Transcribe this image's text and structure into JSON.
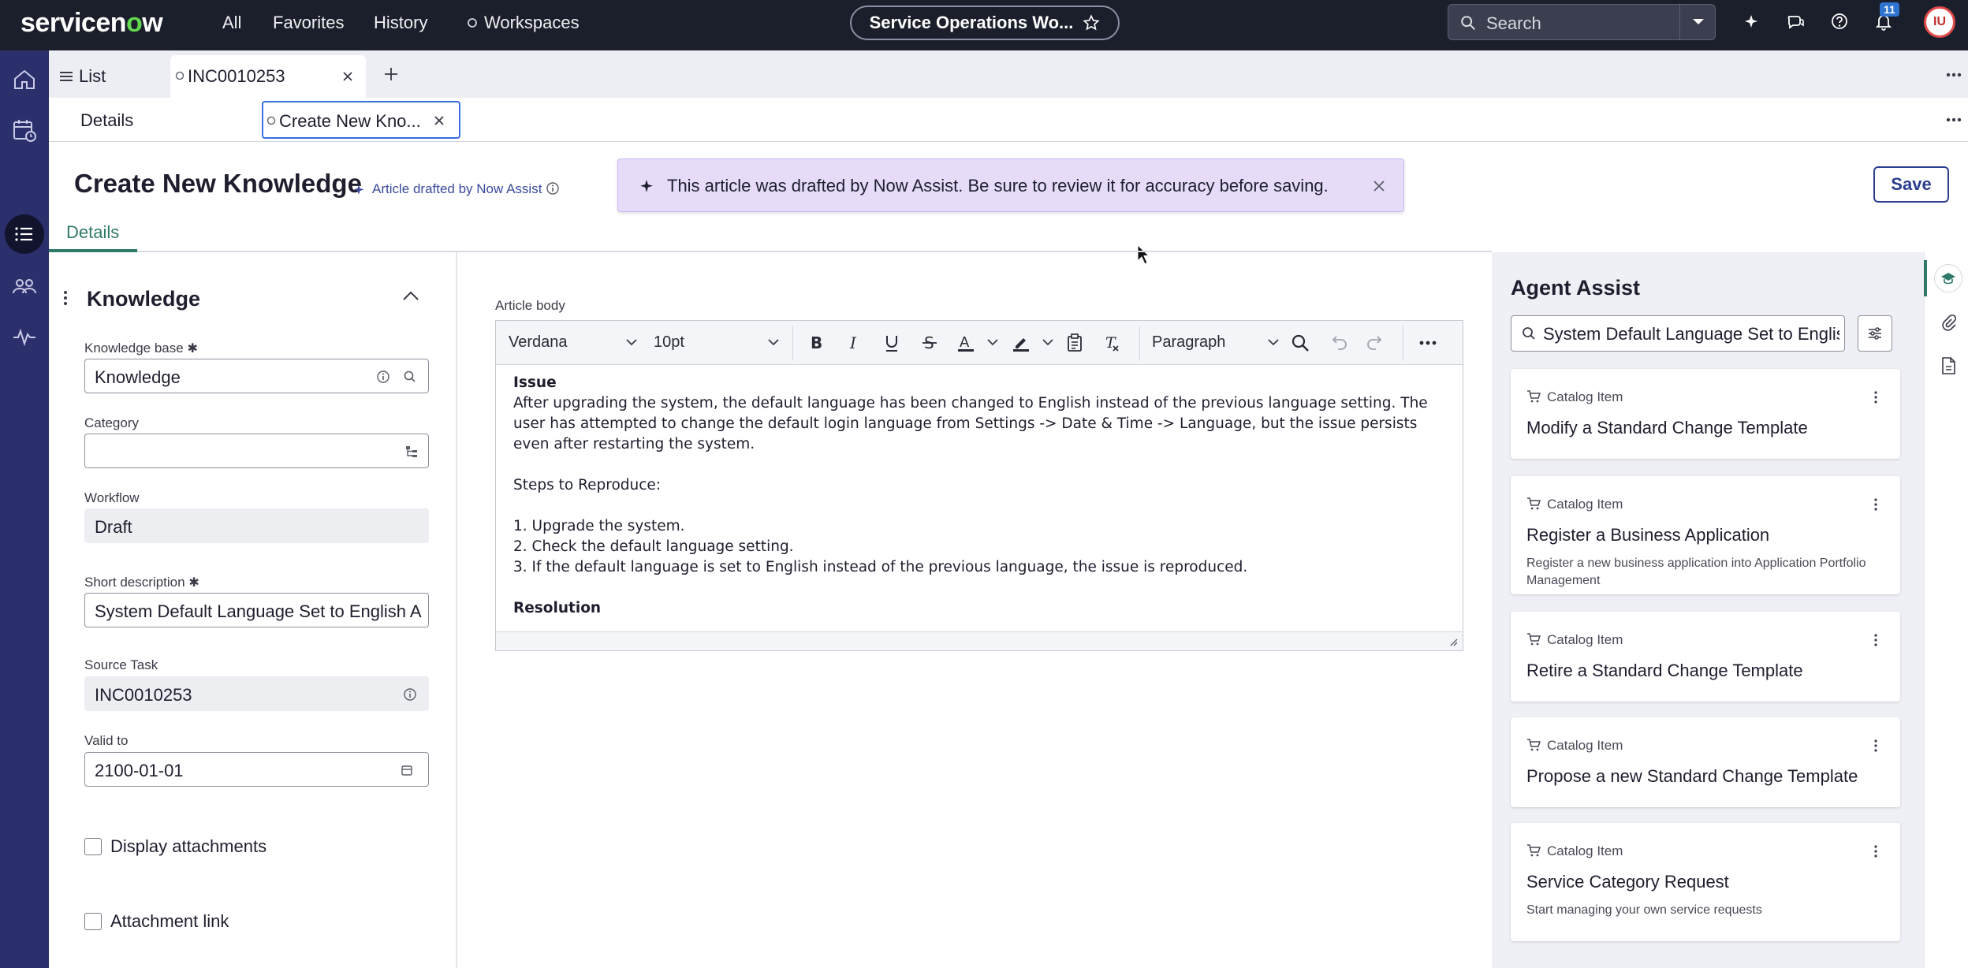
{
  "topbar": {
    "brand_prefix": "servicen",
    "brand_o": "o",
    "brand_suffix": "w",
    "nav": [
      "All",
      "Favorites",
      "History",
      "Workspaces"
    ],
    "workspace_pill": "Service Operations Wo...",
    "search_placeholder": "Search",
    "notification_count": "11",
    "avatar_initials": "IU"
  },
  "tabs_primary": [
    {
      "label": "List"
    },
    {
      "label": "INC0010253"
    }
  ],
  "tabs_secondary": [
    {
      "label": "Details"
    },
    {
      "label": "Create New Kno..."
    }
  ],
  "header": {
    "title": "Create New Knowledge",
    "drafted_label": "Article drafted by Now Assist",
    "banner_text": "This article was drafted by Now Assist. Be sure to review it for accuracy before saving.",
    "save_label": "Save",
    "subtab": "Details"
  },
  "form": {
    "section_title": "Knowledge",
    "fields": {
      "knowledge_base": {
        "label": "Knowledge base",
        "value": "Knowledge"
      },
      "category": {
        "label": "Category",
        "value": ""
      },
      "workflow": {
        "label": "Workflow",
        "value": "Draft"
      },
      "short_description": {
        "label": "Short description",
        "value": "System Default Language Set to English A"
      },
      "source_task": {
        "label": "Source Task",
        "value": "INC0010253"
      },
      "valid_to": {
        "label": "Valid to",
        "value": "2100-01-01"
      }
    },
    "checkboxes": [
      {
        "label": "Display attachments",
        "checked": false
      },
      {
        "label": "Attachment link",
        "checked": false
      }
    ]
  },
  "editor": {
    "label": "Article body",
    "font": "Verdana",
    "size": "10pt",
    "block": "Paragraph",
    "body": {
      "h_issue": "Issue",
      "p1": "After upgrading the system, the default language has been changed to English instead of the previous language setting. The user has attempted to change the default login language from Settings -> Date & Time -> Language, but the issue persists even after restarting the system.",
      "p2": "Steps to Reproduce:",
      "s1": "1. Upgrade the system.",
      "s2": "2. Check the default language setting.",
      "s3": "3. If the default language is set to English instead of the previous language, the issue is reproduced.",
      "h_resolution": "Resolution"
    }
  },
  "agent_assist": {
    "title": "Agent Assist",
    "search_value": "System Default Language Set to Englis",
    "cards": [
      {
        "type": "Catalog Item",
        "title": "Modify a Standard Change Template",
        "desc": ""
      },
      {
        "type": "Catalog Item",
        "title": "Register a Business Application",
        "desc": "Register a new business application into Application Portfolio Management"
      },
      {
        "type": "Catalog Item",
        "title": "Retire a Standard Change Template",
        "desc": ""
      },
      {
        "type": "Catalog Item",
        "title": "Propose a new Standard Change Template",
        "desc": ""
      },
      {
        "type": "Catalog Item",
        "title": "Service Category Request",
        "desc": "Start managing your own service requests"
      }
    ]
  },
  "colors": {
    "topbar": "#1b1e2b",
    "leftrail": "#2b2f6c",
    "banner": "#e6dcfa",
    "accent": "#2b3d8f",
    "brand_green": "#62d84e"
  }
}
